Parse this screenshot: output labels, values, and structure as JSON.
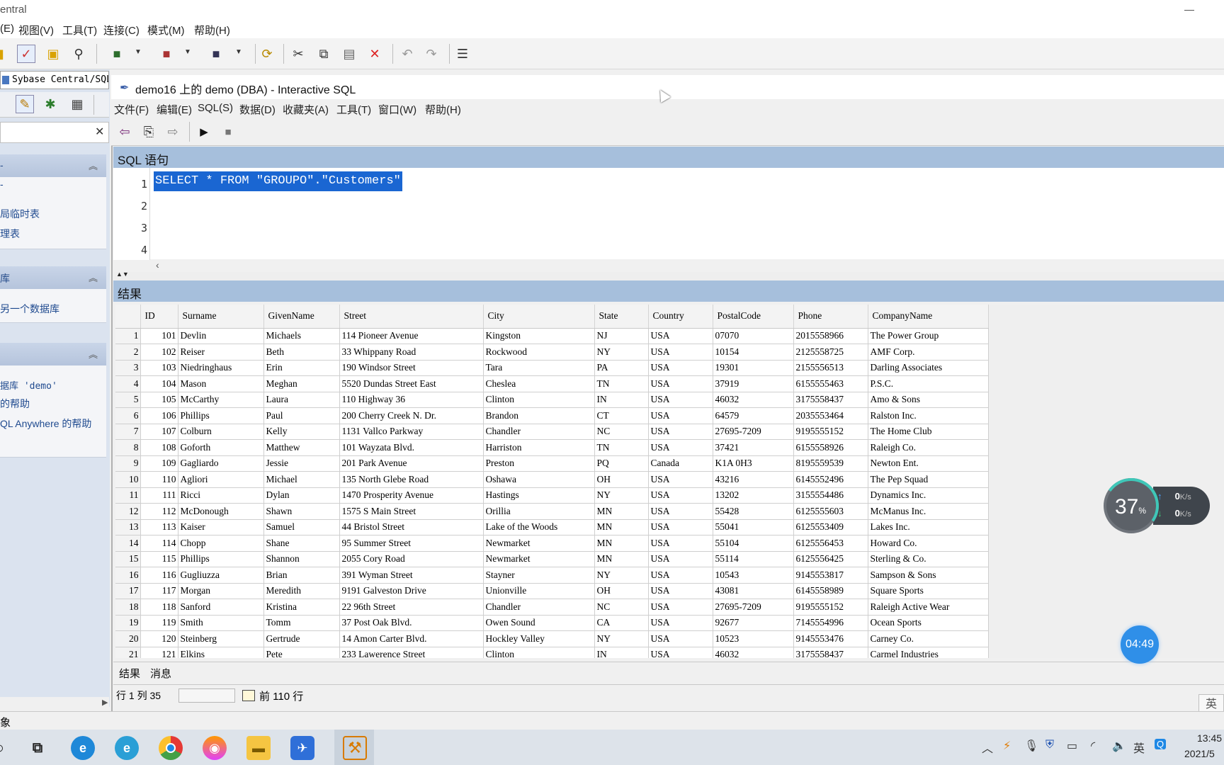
{
  "outer": {
    "title": "entral",
    "menu": [
      "(E)",
      "视图(V)",
      "工具(T)",
      "连接(C)",
      "模式(M)",
      "帮助(H)"
    ],
    "status": "象"
  },
  "left": {
    "tab": "Sybase Central/SQL",
    "panel1_links": [
      "局临时表",
      "理表"
    ],
    "panel2_links": [
      "另一个数据库"
    ],
    "panel3_links": [
      "据库 'demo'",
      "的帮助",
      "QL Anywhere 的帮助"
    ]
  },
  "isql": {
    "title": "demo16 上的 demo (DBA) - Interactive SQL",
    "menu": [
      "文件(F)",
      "编辑(E)",
      "SQL(S)",
      "数据(D)",
      "收藏夹(A)",
      "工具(T)",
      "窗口(W)",
      "帮助(H)"
    ],
    "sql_section": "SQL 语句",
    "sql_lines": [
      "1",
      "2",
      "3",
      "4"
    ],
    "sql_text": "SELECT * FROM \"GROUPO\".\"Customers\"",
    "results_section": "结果",
    "tabs": [
      "结果",
      "消息"
    ],
    "status_pos": "行 1  列 35",
    "status_rows": "前 110 行"
  },
  "results": {
    "columns": [
      "ID",
      "Surname",
      "GivenName",
      "Street",
      "City",
      "State",
      "Country",
      "PostalCode",
      "Phone",
      "CompanyName"
    ],
    "rows": [
      [
        "1",
        "101",
        "Devlin",
        "Michaels",
        "114 Pioneer Avenue",
        "Kingston",
        "NJ",
        "USA",
        "07070",
        "2015558966",
        "The Power Group"
      ],
      [
        "2",
        "102",
        "Reiser",
        "Beth",
        "33 Whippany Road",
        "Rockwood",
        "NY",
        "USA",
        "10154",
        "2125558725",
        "AMF Corp."
      ],
      [
        "3",
        "103",
        "Niedringhaus",
        "Erin",
        "190 Windsor Street",
        "Tara",
        "PA",
        "USA",
        "19301",
        "2155556513",
        "Darling Associates"
      ],
      [
        "4",
        "104",
        "Mason",
        "Meghan",
        "5520 Dundas Street East",
        "Cheslea",
        "TN",
        "USA",
        "37919",
        "6155555463",
        "P.S.C."
      ],
      [
        "5",
        "105",
        "McCarthy",
        "Laura",
        "110 Highway 36",
        "Clinton",
        "IN",
        "USA",
        "46032",
        "3175558437",
        "Amo & Sons"
      ],
      [
        "6",
        "106",
        "Phillips",
        "Paul",
        "200 Cherry Creek N. Dr.",
        "Brandon",
        "CT",
        "USA",
        "64579",
        "2035553464",
        "Ralston Inc."
      ],
      [
        "7",
        "107",
        "Colburn",
        "Kelly",
        "1131 Vallco Parkway",
        "Chandler",
        "NC",
        "USA",
        "27695-7209",
        "9195555152",
        "The Home Club"
      ],
      [
        "8",
        "108",
        "Goforth",
        "Matthew",
        "101 Wayzata Blvd.",
        "Harriston",
        "TN",
        "USA",
        "37421",
        "6155558926",
        "Raleigh Co."
      ],
      [
        "9",
        "109",
        "Gagliardo",
        "Jessie",
        "201 Park Avenue",
        "Preston",
        "PQ",
        "Canada",
        "K1A 0H3",
        "8195559539",
        "Newton Ent."
      ],
      [
        "10",
        "110",
        "Agliori",
        "Michael",
        "135 North Glebe Road",
        "Oshawa",
        "OH",
        "USA",
        "43216",
        "6145552496",
        "The Pep Squad"
      ],
      [
        "11",
        "111",
        "Ricci",
        "Dylan",
        "1470 Prosperity Avenue",
        "Hastings",
        "NY",
        "USA",
        "13202",
        "3155554486",
        "Dynamics Inc."
      ],
      [
        "12",
        "112",
        "McDonough",
        "Shawn",
        "1575 S Main Street",
        "Orillia",
        "MN",
        "USA",
        "55428",
        "6125555603",
        "McManus Inc."
      ],
      [
        "13",
        "113",
        "Kaiser",
        "Samuel",
        "44 Bristol Street",
        "Lake of the Woods",
        "MN",
        "USA",
        "55041",
        "6125553409",
        "Lakes Inc."
      ],
      [
        "14",
        "114",
        "Chopp",
        "Shane",
        "95 Summer Street",
        "Newmarket",
        "MN",
        "USA",
        "55104",
        "6125556453",
        "Howard Co."
      ],
      [
        "15",
        "115",
        "Phillips",
        "Shannon",
        "2055 Cory Road",
        "Newmarket",
        "MN",
        "USA",
        "55114",
        "6125556425",
        "Sterling & Co."
      ],
      [
        "16",
        "116",
        "Gugliuzza",
        "Brian",
        "391 Wyman Street",
        "Stayner",
        "NY",
        "USA",
        "10543",
        "9145553817",
        "Sampson & Sons"
      ],
      [
        "17",
        "117",
        "Morgan",
        "Meredith",
        "9191 Galveston Drive",
        "Unionville",
        "OH",
        "USA",
        "43081",
        "6145558989",
        "Square Sports"
      ],
      [
        "18",
        "118",
        "Sanford",
        "Kristina",
        "22 96th Street",
        "Chandler",
        "NC",
        "USA",
        "27695-7209",
        "9195555152",
        "Raleigh Active Wear"
      ],
      [
        "19",
        "119",
        "Smith",
        "Tomm",
        "37 Post Oak Blvd.",
        "Owen Sound",
        "CA",
        "USA",
        "92677",
        "7145554996",
        "Ocean Sports"
      ],
      [
        "20",
        "120",
        "Steinberg",
        "Gertrude",
        "14 Amon Carter Blvd.",
        "Hockley Valley",
        "NY",
        "USA",
        "10523",
        "9145553476",
        "Carney Co."
      ],
      [
        "21",
        "121",
        "Elkins",
        "Pete",
        "233 Lawerence Street",
        "Clinton",
        "IN",
        "USA",
        "46032",
        "3175558437",
        "Carmel Industries"
      ]
    ]
  },
  "overlay": {
    "cpu_pct": "37",
    "pct_sign": "%",
    "upload": "0",
    "download": "0",
    "speed_unit": "K/s",
    "timer": "04:49",
    "ime": "英"
  },
  "taskbar": {
    "ime": "英",
    "time": "13:45",
    "date": "2021/5"
  },
  "colors": {
    "selection": "#1a66d2",
    "section_header": "#a6bfdc",
    "left_panel": "#dbe3ef",
    "taskbar": "#dde3ea"
  }
}
